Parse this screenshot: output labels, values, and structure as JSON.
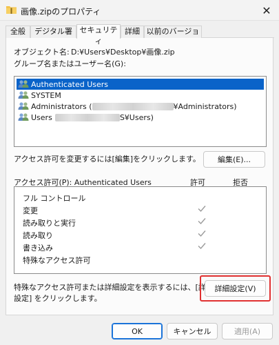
{
  "window": {
    "title": "画像.zipのプロパティ",
    "close_glyph": "✕"
  },
  "tabs": [
    {
      "label": "全般"
    },
    {
      "label": "デジタル署名"
    },
    {
      "label": "セキュリティ",
      "active": true
    },
    {
      "label": "詳細"
    },
    {
      "label": "以前のバージョン"
    }
  ],
  "security": {
    "object_name_label": "オブジェクト名:",
    "object_name_value": "D:¥Users¥Desktop¥画像.zip",
    "groups_label": "グループ名またはユーザー名(G):",
    "users": [
      {
        "name": "Authenticated Users",
        "selected": true
      },
      {
        "name": "SYSTEM"
      },
      {
        "prefix": "Administrators (",
        "suffix": "¥Administrators)"
      },
      {
        "prefix": "Users",
        "suffix": "S¥Users)"
      }
    ],
    "edit_hint": "アクセス許可を変更するには[編集]をクリックします。",
    "edit_button": "編集(E)...",
    "perm_header": "アクセス許可(P): Authenticated Users",
    "perm_allow_header": "許可",
    "perm_deny_header": "拒否",
    "permissions": [
      {
        "name": "フル コントロール",
        "allow": false
      },
      {
        "name": "変更",
        "allow": true
      },
      {
        "name": "読み取りと実行",
        "allow": true
      },
      {
        "name": "読み取り",
        "allow": true
      },
      {
        "name": "書き込み",
        "allow": true
      },
      {
        "name": "特殊なアクセス許可",
        "allow": false
      }
    ],
    "advanced_hint_line1": "特殊なアクセス許可または詳細設定を表示するには、[詳細",
    "advanced_hint_line2": "設定] をクリックします。",
    "advanced_button": "詳細設定(V)"
  },
  "footer": {
    "ok": "OK",
    "cancel": "キャンセル",
    "apply": "適用(A)"
  },
  "colors": {
    "selection": "#0a63c9",
    "highlight_border": "#e03030",
    "primary_border": "#1a73d9"
  }
}
